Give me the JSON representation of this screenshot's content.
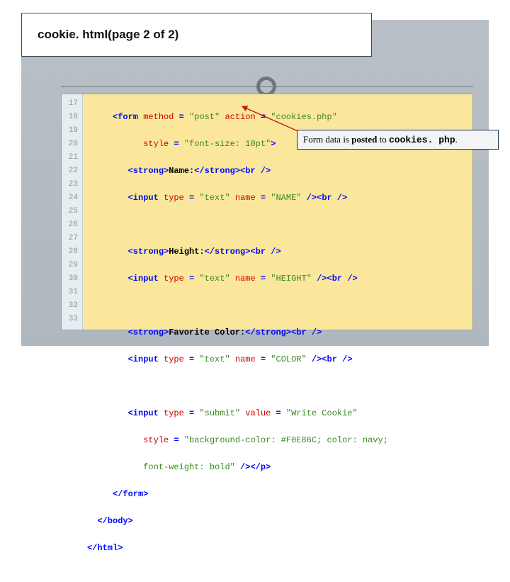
{
  "title": "cookie. html(page 2 of 2)",
  "callout": {
    "prefix": "Form data is ",
    "verb": "posted",
    "mid": " to ",
    "target": "cookies. php",
    "suffix": "."
  },
  "gutter": [
    "17",
    "18",
    "19",
    "20",
    "21",
    "22",
    "23",
    "24",
    "25",
    "26",
    "27",
    "28",
    "29",
    "30",
    "31",
    "32",
    "33"
  ],
  "code": {
    "l17": {
      "a": "     <form ",
      "b": "method ",
      "c": "= ",
      "d": "\"post\" ",
      "e": "action ",
      "f": "= ",
      "g": "\"cookies.php\""
    },
    "l18": {
      "a": "           ",
      "b": "style ",
      "c": "= ",
      "d": "\"font-size: 10pt\"",
      "e": ">"
    },
    "l19": {
      "a": "        <strong>",
      "b": "Name:",
      "c": "</strong><br />"
    },
    "l20": {
      "a": "        <input ",
      "b": "type ",
      "c": "= ",
      "d": "\"text\" ",
      "e": "name ",
      "f": "= ",
      "g": "\"NAME\" ",
      "h": "/><br />"
    },
    "l21": {
      "a": ""
    },
    "l22": {
      "a": "        <strong>",
      "b": "Height:",
      "c": "</strong><br />"
    },
    "l23": {
      "a": "        <input ",
      "b": "type ",
      "c": "= ",
      "d": "\"text\" ",
      "e": "name ",
      "f": "= ",
      "g": "\"HEIGHT\" ",
      "h": "/><br />"
    },
    "l24": {
      "a": ""
    },
    "l25": {
      "a": "        <strong>",
      "b": "Favorite Color:",
      "c": "</strong><br />"
    },
    "l26": {
      "a": "        <input ",
      "b": "type ",
      "c": "= ",
      "d": "\"text\" ",
      "e": "name ",
      "f": "= ",
      "g": "\"COLOR\" ",
      "h": "/><br />"
    },
    "l27": {
      "a": ""
    },
    "l28": {
      "a": "        <input ",
      "b": "type ",
      "c": "= ",
      "d": "\"submit\" ",
      "e": "value ",
      "f": "= ",
      "g": "\"Write Cookie\""
    },
    "l29": {
      "a": "           ",
      "b": "style ",
      "c": "= ",
      "d": "\"background-color: #F0E86C; color: navy;"
    },
    "l30": {
      "a": "           ",
      "b": "font-weight: bold\" ",
      "c": "/></p>"
    },
    "l31": {
      "a": "     </form>"
    },
    "l32": {
      "a": "  </body>"
    },
    "l33": {
      "a": "</html>"
    }
  }
}
